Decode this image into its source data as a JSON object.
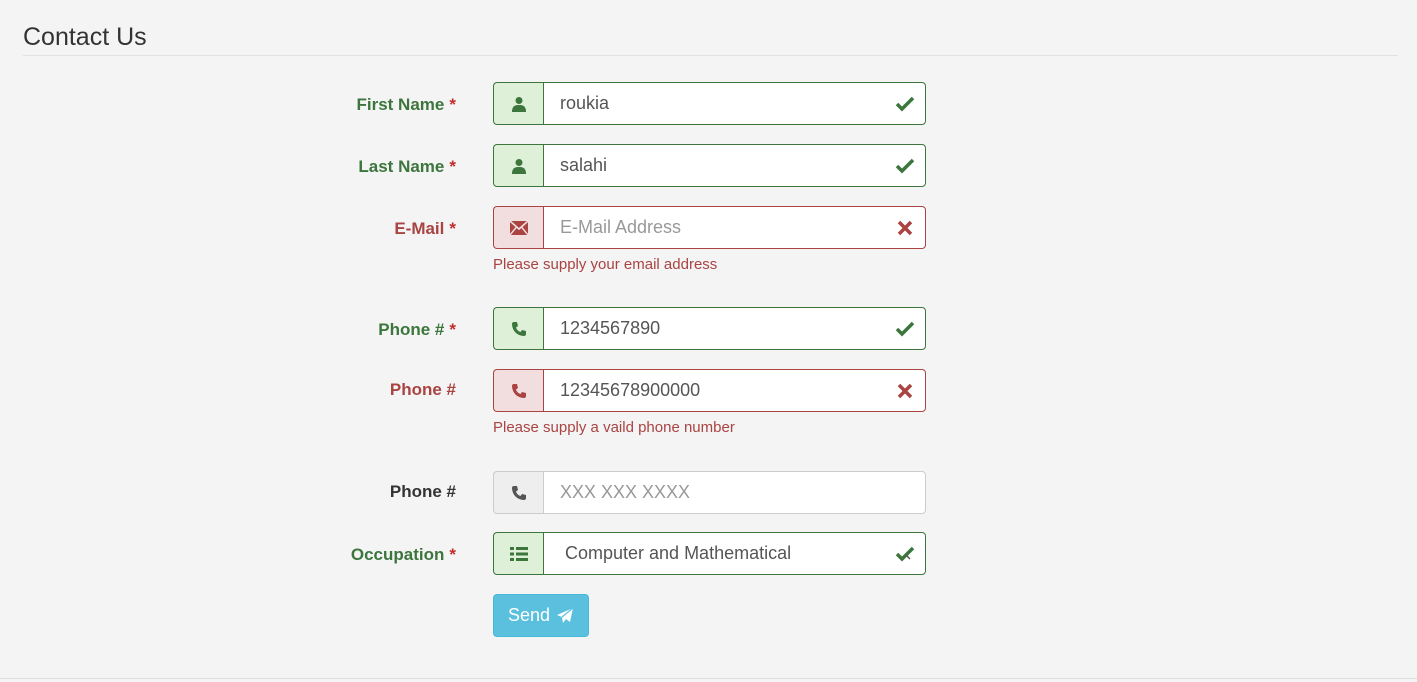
{
  "form": {
    "legend": "Contact Us",
    "required_mark": "*",
    "fields": [
      {
        "label": "First Name",
        "value": "roukia",
        "placeholder": "",
        "icon": "user-icon",
        "status": "success"
      },
      {
        "label": "Last Name",
        "value": "salahi",
        "placeholder": "",
        "icon": "user-icon",
        "status": "success"
      },
      {
        "label": "E-Mail",
        "value": "",
        "placeholder": "E-Mail Address",
        "icon": "envelope-icon",
        "status": "error",
        "help": "Please supply your email address"
      },
      {
        "label": "Phone #",
        "value": "1234567890",
        "placeholder": "",
        "icon": "phone-icon",
        "status": "success"
      },
      {
        "label": "Phone #",
        "value": "12345678900000",
        "placeholder": "",
        "icon": "phone-icon",
        "status": "error",
        "help": "Please supply a vaild phone number"
      },
      {
        "label": "Phone #",
        "value": "",
        "placeholder": "XXX XXX XXXX",
        "icon": "phone-icon",
        "status": "neutral"
      },
      {
        "label": "Occupation",
        "value": "Computer and Mathematical",
        "icon": "list-icon",
        "status": "success"
      }
    ],
    "send_label": "Send"
  },
  "colors": {
    "success": "#3c763d",
    "error": "#a94442",
    "info_button": "#5bc0de",
    "background": "#f4f4f4"
  }
}
